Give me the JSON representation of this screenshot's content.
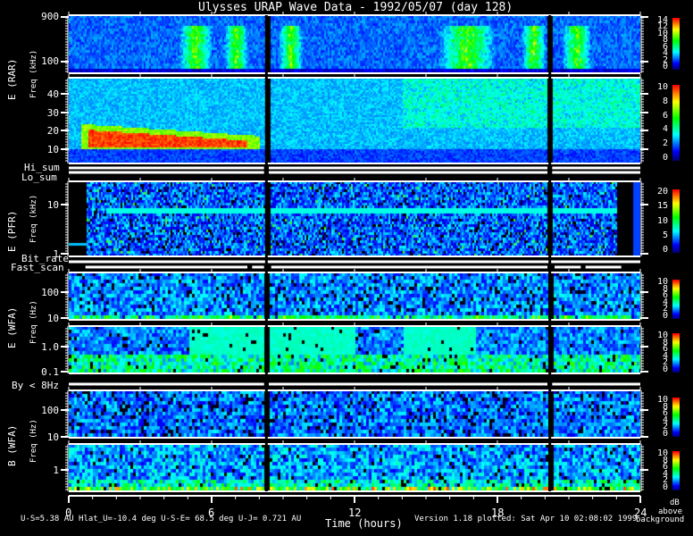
{
  "title": "Ulysses URAP Wave Data - 1992/05/07  (day 128)",
  "chart_data": {
    "type": "heatmap",
    "title": "Ulysses URAP Wave Data - 1992/05/07  (day 128)",
    "xlabel": "Time (hours)",
    "xlim": [
      0,
      24
    ],
    "xticks": [
      "0",
      "6",
      "12",
      "18",
      "24"
    ],
    "colorscale": [
      "#000000",
      "#0000ff",
      "#00ffff",
      "#00ff00",
      "#ffff00",
      "#ff0000"
    ],
    "colorbar_unit": [
      "dB",
      "above",
      "background"
    ],
    "panels": [
      {
        "id": "rar-high",
        "ylabel": "E (RAR)",
        "yunit": "Freq (kHz)",
        "yscale": "log",
        "yticks": [
          "900",
          "100"
        ],
        "colorbar_ticks": [
          "0",
          "2",
          "4",
          "6",
          "8",
          "10",
          "12",
          "14"
        ],
        "clim": [
          0,
          14
        ]
      },
      {
        "id": "rar-low",
        "ylabel": "E (RAR)",
        "yunit": "Freq (kHz)",
        "yscale": "linear",
        "yticks": [
          "40",
          "30",
          "20",
          "10"
        ],
        "colorbar_ticks": [
          "0",
          "2",
          "4",
          "6",
          "8",
          "10"
        ],
        "clim": [
          0,
          10
        ]
      },
      {
        "id": "pfr",
        "ylabel": "E (PFR)",
        "yunit": "Freq (kHz)",
        "yscale": "log",
        "yticks": [
          "10",
          "1"
        ],
        "colorbar_ticks": [
          "0",
          "5",
          "10",
          "15",
          "20"
        ],
        "clim": [
          0,
          20
        ]
      },
      {
        "id": "wfa-e-high",
        "ylabel": "E (WFA)",
        "yunit": "Freq (Hz)",
        "yscale": "log",
        "yticks": [
          "100",
          "10"
        ],
        "colorbar_ticks": [
          "0",
          "2",
          "4",
          "6",
          "8",
          "10"
        ],
        "clim": [
          0,
          10
        ]
      },
      {
        "id": "wfa-e-low",
        "ylabel": "E (WFA)",
        "yunit": "Freq (Hz)",
        "yscale": "log",
        "yticks": [
          "1.0",
          "0.1"
        ],
        "colorbar_ticks": [
          "0",
          "2",
          "4",
          "6",
          "8",
          "10"
        ],
        "clim": [
          0,
          10
        ]
      },
      {
        "id": "wfa-b-high",
        "ylabel": "B (WFA)",
        "yunit": "Freq (Hz)",
        "yscale": "log",
        "yticks": [
          "100",
          "10"
        ],
        "colorbar_ticks": [
          "0",
          "2",
          "4",
          "6",
          "8",
          "10"
        ],
        "clim": [
          0,
          10
        ]
      },
      {
        "id": "wfa-b-low",
        "ylabel": "B (WFA)",
        "yunit": "Freq (Hz)",
        "yscale": "log",
        "yticks": [
          "1"
        ],
        "colorbar_ticks": [
          "0",
          "2",
          "4",
          "6",
          "8",
          "10"
        ],
        "clim": [
          0,
          10
        ]
      }
    ],
    "mode_bars": [
      "Hi_sum",
      "Lo_sum",
      "Bit_rate",
      "Fast_scan",
      "By < 8Hz"
    ]
  },
  "labels": {
    "e_rar": "E (RAR)",
    "e_pfr": "E (PFR)",
    "e_wfa": "E (WFA)",
    "b_wfa": "B (WFA)",
    "freq_khz": "Freq (kHz)",
    "freq_hz": "Freq (Hz)"
  },
  "footer": {
    "ephemeris": "U-S=5.38 AU  Hlat_U=-10.4 deg  U-S-E= 68.5 deg  U-J= 0.721 AU",
    "version": "Version 1.18 plotted: Sat Apr 10 02:08:02 1999",
    "unit1": "dB",
    "unit2": "above",
    "unit3": "background"
  }
}
